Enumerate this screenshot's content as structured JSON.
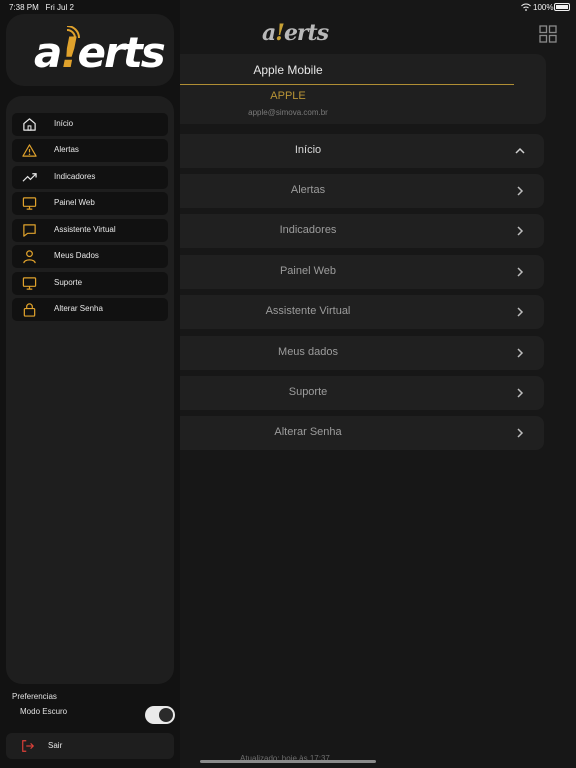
{
  "status_bar": {
    "time": "7:38 PM",
    "date": "Fri Jul 2",
    "battery": "100%"
  },
  "header": {
    "logo_text_pre": "a",
    "logo_text_bang": "!",
    "logo_text_post": "erts"
  },
  "profile": {
    "name": "Apple Mobile",
    "company": "APPLE",
    "email": "apple@simova.com.br"
  },
  "main_menu": [
    {
      "label": "Início"
    },
    {
      "label": "Alertas"
    },
    {
      "label": "Indicadores"
    },
    {
      "label": "Painel Web"
    },
    {
      "label": "Assistente Virtual"
    },
    {
      "label": "Meus dados"
    },
    {
      "label": "Suporte"
    },
    {
      "label": "Alterar Senha"
    }
  ],
  "updated_text": "Atualizado: hoje às 17:37",
  "drawer": {
    "logo_text_pre": "a",
    "logo_text_bang": "!",
    "logo_text_post": "erts",
    "items": [
      {
        "label": "Início",
        "icon": "home-icon"
      },
      {
        "label": "Alertas",
        "icon": "warning-icon"
      },
      {
        "label": "Indicadores",
        "icon": "trending-up-icon"
      },
      {
        "label": "Painel Web",
        "icon": "monitor-icon"
      },
      {
        "label": "Assistente Virtual",
        "icon": "chat-icon"
      },
      {
        "label": "Meus Dados",
        "icon": "user-icon"
      },
      {
        "label": "Suporte",
        "icon": "monitor-icon"
      },
      {
        "label": "Alterar Senha",
        "icon": "lock-icon"
      }
    ],
    "preferences_title": "Preferencias",
    "dark_mode_label": "Modo Escuro",
    "dark_mode_enabled": true,
    "logout_label": "Sair"
  },
  "colors": {
    "accent": "#e0a22c",
    "gold": "#b89436",
    "logout_red": "#e0413a"
  }
}
